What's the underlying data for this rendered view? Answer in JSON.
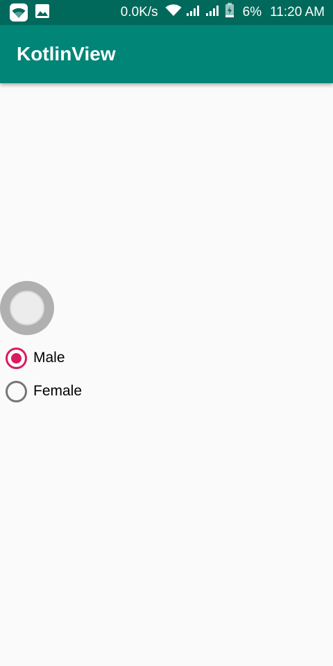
{
  "status_bar": {
    "net_speed": "0.0K/s",
    "battery_percent": "6%",
    "time": "11:20 AM",
    "icons": [
      "wifi-app-icon",
      "image-icon",
      "wifi-icon",
      "signal-icon",
      "signal-icon",
      "battery-charging-icon"
    ]
  },
  "app_bar": {
    "title": "KotlinView",
    "color": "#008577"
  },
  "switch": {
    "checked": false
  },
  "gender_radio_group": {
    "selected": "Male",
    "accent_color": "#d81b60",
    "options": [
      {
        "label": "Male",
        "checked": true
      },
      {
        "label": "Female",
        "checked": false
      }
    ]
  }
}
